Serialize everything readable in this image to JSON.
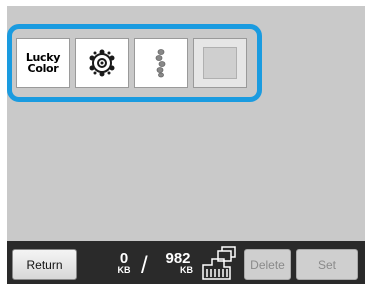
{
  "patterns": {
    "tiles": [
      {
        "label_line1": "Lucky",
        "label_line2": "Color",
        "icon": "lucky-color-text"
      },
      {
        "icon": "flower-lace-icon"
      },
      {
        "icon": "vertical-stitch-icon"
      },
      {
        "icon": "blank-pattern-icon"
      }
    ]
  },
  "footer": {
    "return_label": "Return",
    "used_memory": "0",
    "used_unit": "KB",
    "separator": "/",
    "total_memory": "982",
    "total_unit": "KB",
    "machine_icon": "sewing-machine-memory-icon",
    "delete_label": "Delete",
    "set_label": "Set"
  },
  "colors": {
    "selection_border": "#1a9be0",
    "screen_bg": "#c9c9c9",
    "footer_bg": "#2a2a2a"
  }
}
